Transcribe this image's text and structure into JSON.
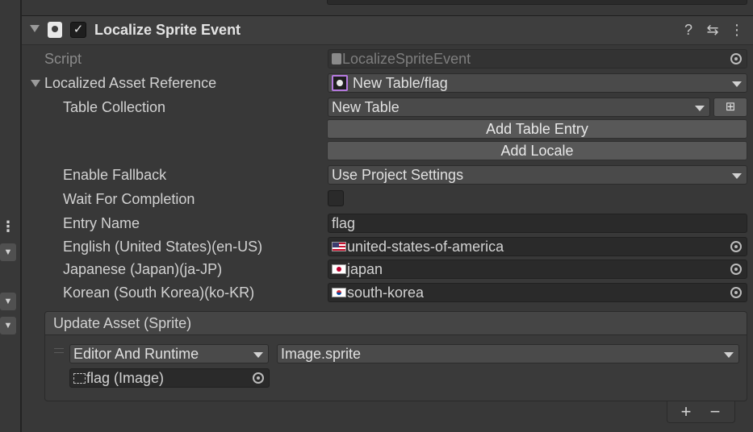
{
  "component": {
    "title": "Localize Sprite Event"
  },
  "fields": {
    "script_label": "Script",
    "script_value": "LocalizeSpriteEvent",
    "localized_asset_label": "Localized Asset Reference",
    "localized_asset_value": "New Table/flag",
    "table_collection_label": "Table Collection",
    "table_collection_value": "New Table",
    "add_table_entry_label": "Add Table Entry",
    "add_locale_label": "Add Locale",
    "enable_fallback_label": "Enable Fallback",
    "enable_fallback_value": "Use Project Settings",
    "wait_for_completion_label": "Wait For Completion",
    "wait_for_completion_checked": false,
    "entry_name_label": "Entry Name",
    "entry_name_value": "flag"
  },
  "locales": [
    {
      "label": "English (United States)(en-US)",
      "value": "united-states-of-america",
      "flag": "us-flag-icon"
    },
    {
      "label": "Japanese (Japan)(ja-JP)",
      "value": "japan",
      "flag": "jp-flag-icon"
    },
    {
      "label": "Korean (South Korea)(ko-KR)",
      "value": "south-korea",
      "flag": "kr-flag-icon"
    }
  ],
  "event": {
    "title": "Update Asset (Sprite)",
    "mode": "Editor And Runtime",
    "function": "Image.sprite",
    "target": "flag (Image)",
    "add_label": "+",
    "remove_label": "−"
  },
  "icons": {
    "help": "?",
    "presets": "⇆",
    "menu": "⋮",
    "table_picker": "⊞"
  },
  "colors": {
    "background": "#383838",
    "asset_icon_border": "#b67ae0"
  }
}
